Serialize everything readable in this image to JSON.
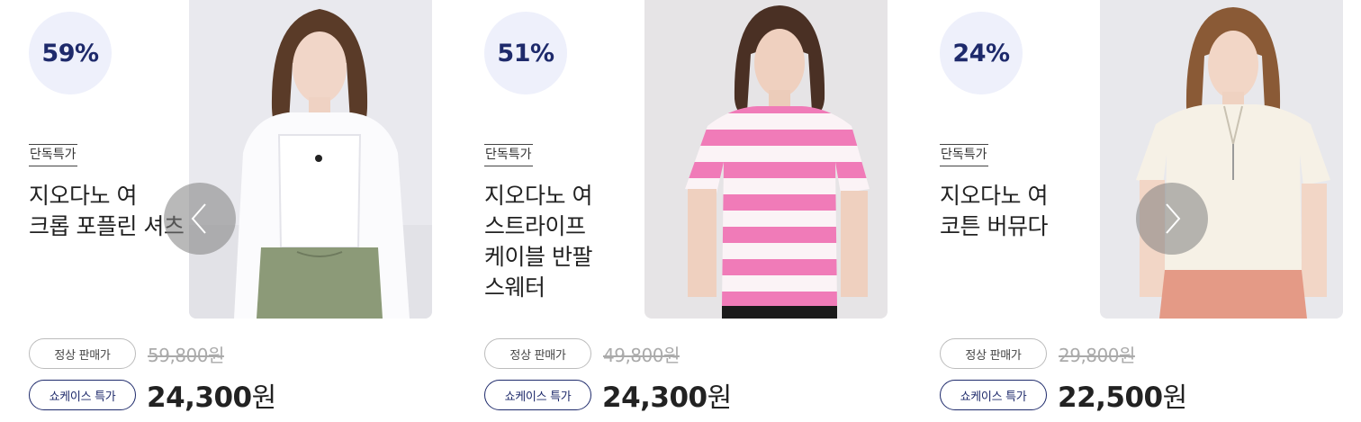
{
  "carousel": {
    "prev_icon": "chevron-left-icon",
    "next_icon": "chevron-right-icon"
  },
  "colors": {
    "accent_navy": "#1e2a6b",
    "badge_bg": "#eef0fb",
    "strike_gray": "#aaaaaa"
  },
  "products": [
    {
      "discount": "59%",
      "tag": "단독특가",
      "title_lines": [
        "지오다노 여",
        "크롭 포플린 셔츠"
      ],
      "regular_label": "정상 판매가",
      "regular_price": "59,800원",
      "special_label": "쇼케이스 특가",
      "sale_price": "24,300",
      "sale_unit": "원"
    },
    {
      "discount": "51%",
      "tag": "단독특가",
      "title_lines": [
        "지오다노 여",
        "스트라이프",
        "케이블 반팔",
        "스웨터"
      ],
      "regular_label": "정상 판매가",
      "regular_price": "49,800원",
      "special_label": "쇼케이스 특가",
      "sale_price": "24,300",
      "sale_unit": "원"
    },
    {
      "discount": "24%",
      "tag": "단독특가",
      "title_lines": [
        "지오다노 여",
        "코튼 버뮤다"
      ],
      "regular_label": "정상 판매가",
      "regular_price": "29,800원",
      "special_label": "쇼케이스 특가",
      "sale_price": "22,500",
      "sale_unit": "원"
    }
  ]
}
